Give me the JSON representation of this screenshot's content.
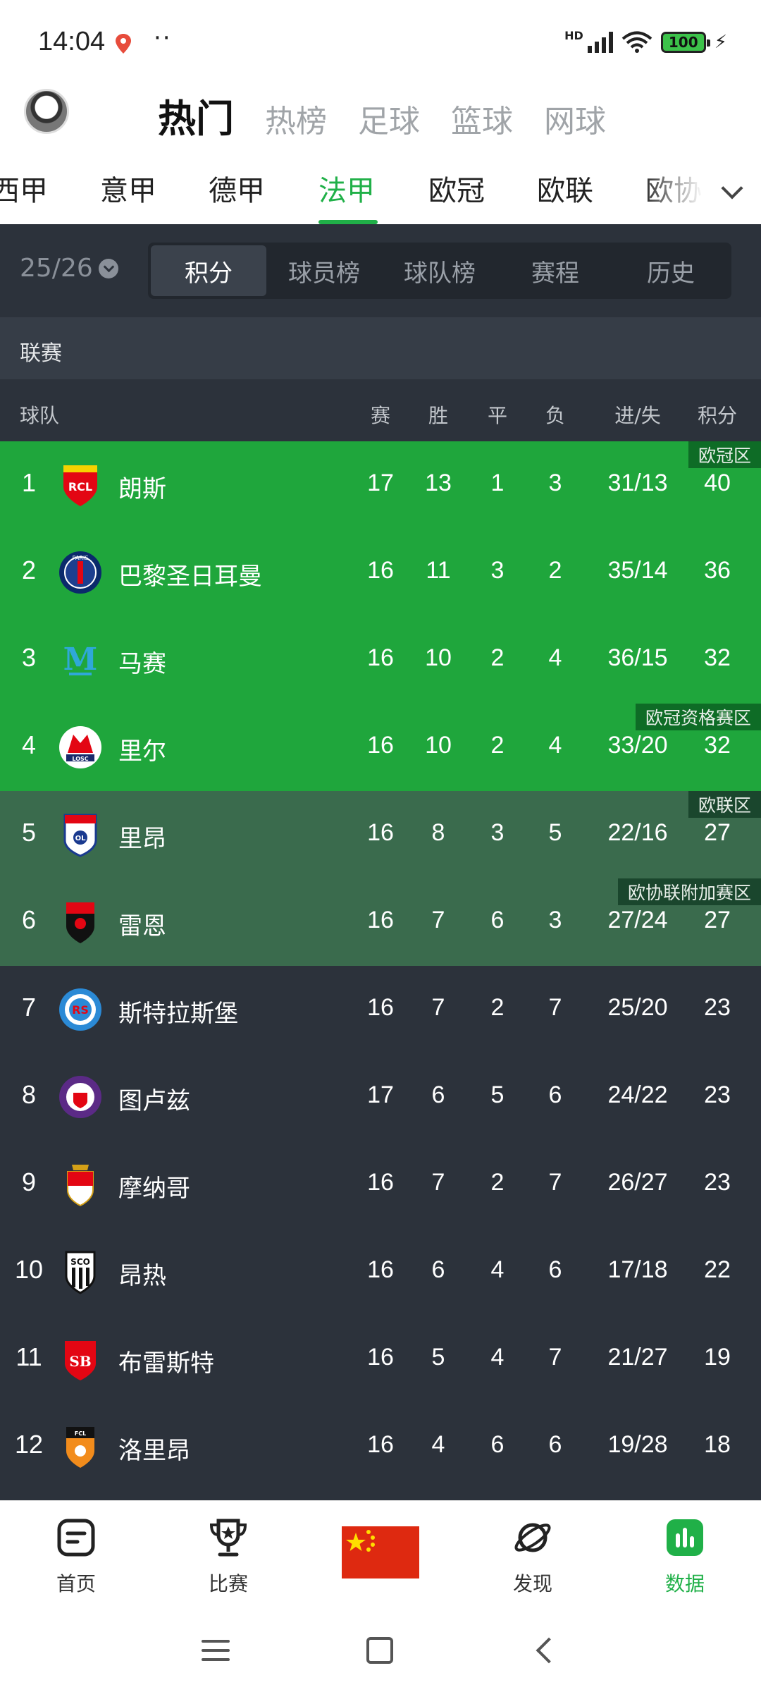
{
  "status_bar": {
    "time": "14:04",
    "dots": "··",
    "hd": "HD",
    "battery": "100",
    "bolt": "⚡"
  },
  "header": {
    "top_tabs": [
      {
        "label": "热门",
        "active": true
      },
      {
        "label": "热榜"
      },
      {
        "label": "足球"
      },
      {
        "label": "篮球"
      },
      {
        "label": "网球"
      }
    ],
    "league_tabs": [
      {
        "label": "西甲"
      },
      {
        "label": "意甲"
      },
      {
        "label": "德甲"
      },
      {
        "label": "法甲",
        "active": true
      },
      {
        "label": "欧冠"
      },
      {
        "label": "欧联"
      },
      {
        "label": "欧协"
      }
    ]
  },
  "season": {
    "label": "25/26"
  },
  "segments": [
    "积分",
    "球员榜",
    "球队榜",
    "赛程",
    "历史"
  ],
  "section_label": "联赛",
  "columns": {
    "team": "球队",
    "played": "赛",
    "won": "胜",
    "drawn": "平",
    "lost": "负",
    "goals": "进/失",
    "points": "积分"
  },
  "zones": {
    "ucl": "欧冠区",
    "ucl_qual": "欧冠资格赛区",
    "uel": "欧联区",
    "uecl_playoff": "欧协联附加赛区"
  },
  "standings": [
    {
      "rank": "1",
      "team": "朗斯",
      "p": "17",
      "w": "13",
      "d": "1",
      "l": "3",
      "g": "31/13",
      "pts": "40",
      "zone": "ucl"
    },
    {
      "rank": "2",
      "team": "巴黎圣日耳曼",
      "p": "16",
      "w": "11",
      "d": "3",
      "l": "2",
      "g": "35/14",
      "pts": "36",
      "zone": "ucl"
    },
    {
      "rank": "3",
      "team": "马赛",
      "p": "16",
      "w": "10",
      "d": "2",
      "l": "4",
      "g": "36/15",
      "pts": "32",
      "zone": "ucl"
    },
    {
      "rank": "4",
      "team": "里尔",
      "p": "16",
      "w": "10",
      "d": "2",
      "l": "4",
      "g": "33/20",
      "pts": "32",
      "zone": "ucl"
    },
    {
      "rank": "5",
      "team": "里昂",
      "p": "16",
      "w": "8",
      "d": "3",
      "l": "5",
      "g": "22/16",
      "pts": "27",
      "zone": "uel"
    },
    {
      "rank": "6",
      "team": "雷恩",
      "p": "16",
      "w": "7",
      "d": "6",
      "l": "3",
      "g": "27/24",
      "pts": "27",
      "zone": "uel"
    },
    {
      "rank": "7",
      "team": "斯特拉斯堡",
      "p": "16",
      "w": "7",
      "d": "2",
      "l": "7",
      "g": "25/20",
      "pts": "23",
      "zone": "none"
    },
    {
      "rank": "8",
      "team": "图卢兹",
      "p": "17",
      "w": "6",
      "d": "5",
      "l": "6",
      "g": "24/22",
      "pts": "23",
      "zone": "none"
    },
    {
      "rank": "9",
      "team": "摩纳哥",
      "p": "16",
      "w": "7",
      "d": "2",
      "l": "7",
      "g": "26/27",
      "pts": "23",
      "zone": "none"
    },
    {
      "rank": "10",
      "team": "昂热",
      "p": "16",
      "w": "6",
      "d": "4",
      "l": "6",
      "g": "17/18",
      "pts": "22",
      "zone": "none"
    },
    {
      "rank": "11",
      "team": "布雷斯特",
      "p": "16",
      "w": "5",
      "d": "4",
      "l": "7",
      "g": "21/27",
      "pts": "19",
      "zone": "none"
    },
    {
      "rank": "12",
      "team": "洛里昂",
      "p": "16",
      "w": "4",
      "d": "6",
      "l": "6",
      "g": "19/28",
      "pts": "18",
      "zone": "none"
    }
  ],
  "bottom_nav": [
    {
      "label": "首页",
      "icon": "home-doc-icon"
    },
    {
      "label": "比赛",
      "icon": "trophy-icon"
    },
    {
      "label": "",
      "icon": "china-flag-icon"
    },
    {
      "label": "发现",
      "icon": "planet-icon"
    },
    {
      "label": "数据",
      "icon": "bar-chart-icon",
      "active": true
    }
  ],
  "colors": {
    "accent": "#20b048",
    "ucl_row": "#1fa63c",
    "uel_row": "#3a6b4d",
    "dark_bg": "#2c323b"
  }
}
